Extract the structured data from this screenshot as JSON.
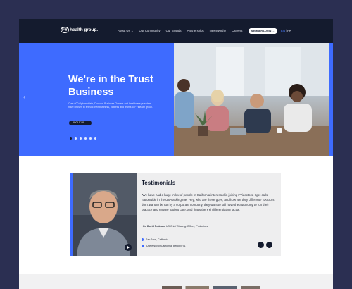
{
  "header": {
    "logo_fy": "FY",
    "logo_text": "health group.",
    "menu": [
      "About Us ⌄",
      "Our Community",
      "Our Brands",
      "Partnerships",
      "Newsworthy",
      "Careers"
    ],
    "member_login": "MEMBER LOGIN →",
    "lang_en": "EN",
    "lang_sep": "|",
    "lang_fr": "FR"
  },
  "hero": {
    "title": "We're in the Trust Business",
    "description": "Over 600 Optometrists, Doctors, Business Owners and healthcare providers have chosen to entrust their business, patients and teams to FYihealth group.",
    "about_button": "ABOUT US →",
    "slides_total": 6,
    "active_slide": 1,
    "arrow": "‹"
  },
  "testimonials": {
    "title": "Testimonials",
    "quote": "\"We have had a huge influx of people in California interested in joining FYidoctors. I get calls nationwide in the USA asking me \"Hey, who are these guys, and how are they different?\" Doctors don't want to be run by a corporate company, they want to still have the autonomy to run their practice and ensure patient care; and that's the FYi differentiating factor.\"",
    "author_name": "- Dr. David Redman,",
    "author_role": " US Chief Strategy Officer, FYidoctors",
    "location": "San Jose, California",
    "education": "University of California, Berkley '91",
    "prev": "←",
    "next": "→"
  },
  "colors": {
    "accent": "#3e6bff",
    "navy": "#141b2e",
    "backdrop": "#2b2f52"
  }
}
